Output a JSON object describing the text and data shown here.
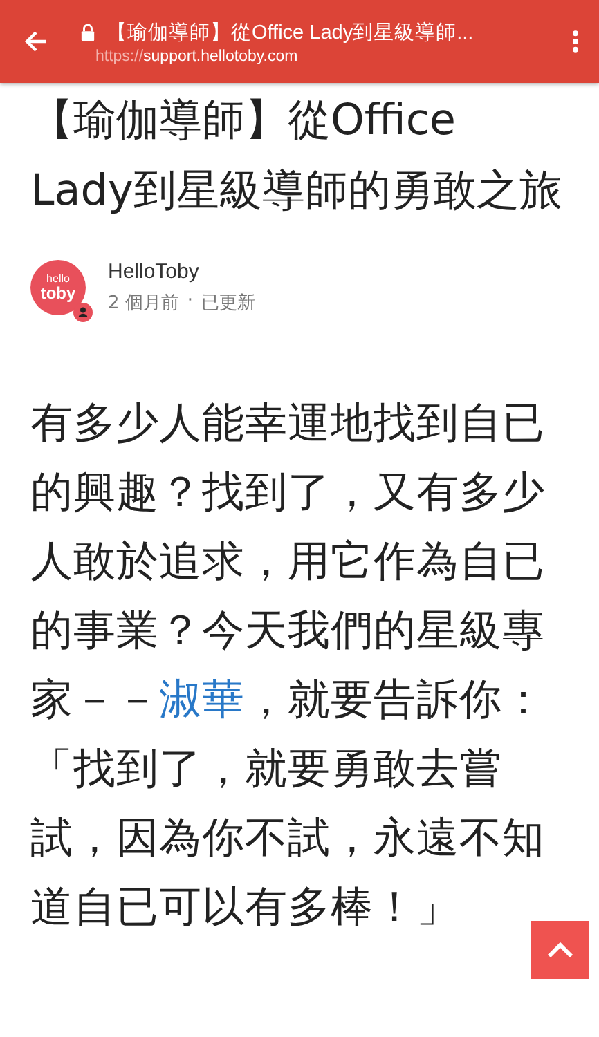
{
  "toolbar": {
    "title": "【瑜伽導師】從Office Lady到星級導師...",
    "url_scheme": "https://",
    "url_host": "support.hellotoby.com"
  },
  "article": {
    "title": "【瑜伽導師】從Office Lady到星級導師的勇敢之旅",
    "author": {
      "logo_lines": [
        "hello",
        "toby"
      ],
      "name": "HelloToby",
      "time": "2 個月前",
      "separator": "·",
      "status": "已更新"
    },
    "paragraph": {
      "before": "有多少人能幸運地找到自已的興趣？找到了，又有多少人敢於追求，用它作為自已的事業？今天我們的星級專家－－",
      "link": "淑華",
      "after": "，就要告訴你：「找到了，就要勇敢去嘗試，因為你不試，永遠不知道自已可以有多棒！」"
    }
  }
}
